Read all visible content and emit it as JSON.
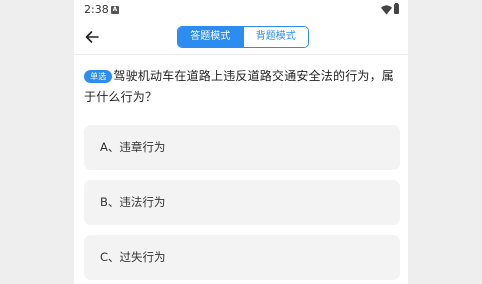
{
  "status_bar": {
    "time": "2:38",
    "notification_glyph": "A"
  },
  "header": {
    "back_icon": "arrow-left-icon",
    "tabs": [
      {
        "label": "答题模式",
        "active": true
      },
      {
        "label": "背题模式",
        "active": false
      }
    ]
  },
  "question": {
    "type_badge": "单选",
    "text": "驾驶机动车在道路上违反道路交通安全法的行为，属于什么行为？"
  },
  "options": [
    {
      "label": "A、违章行为"
    },
    {
      "label": "B、违法行为"
    },
    {
      "label": "C、过失行为"
    }
  ],
  "colors": {
    "accent": "#2d8cf0",
    "option_background": "#f3f3f3",
    "page_background": "#eeeeee"
  }
}
